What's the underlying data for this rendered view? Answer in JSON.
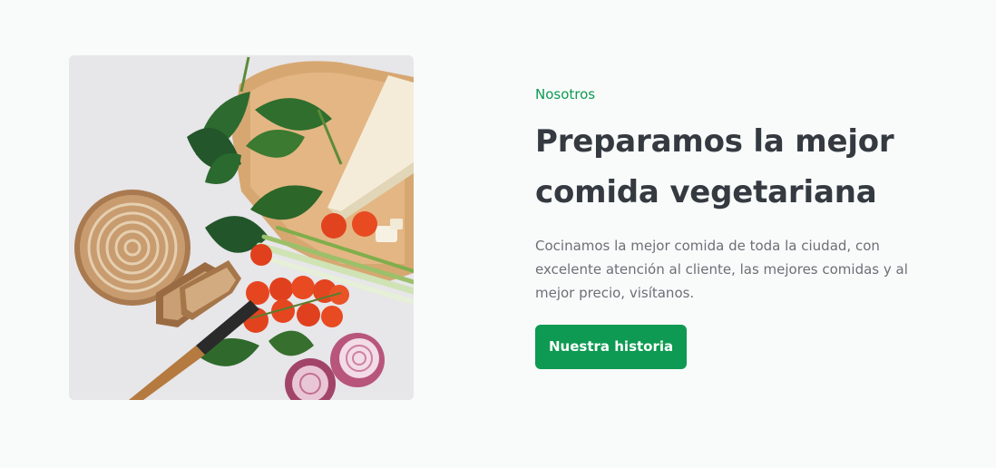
{
  "about": {
    "eyebrow": "Nosotros",
    "heading_line1": "Preparamos la mejor",
    "heading_line2": "comida vegetariana",
    "description": "Cocinamos la mejor comida de toda la ciudad, con excelente atención al cliente, las mejores comidas y al mejor precio, visítanos.",
    "cta_label": "Nuestra historia"
  },
  "colors": {
    "accent": "#0e9a52",
    "heading": "#343a40",
    "body_text": "#6b7075",
    "background": "#f9fbfb"
  }
}
